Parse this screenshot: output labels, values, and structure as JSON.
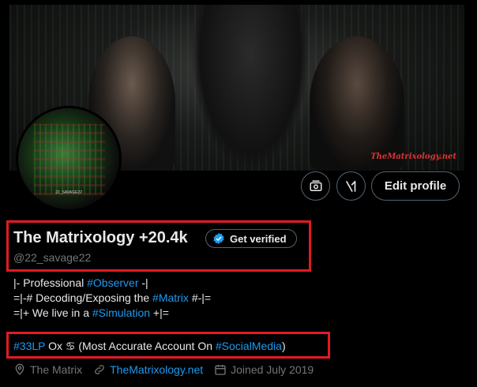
{
  "banner": {
    "watermark": "TheMatrixology.net",
    "avatar_caption": "22_SAVAGE22"
  },
  "actions": {
    "subscriptions_icon": "money-icon",
    "grok_icon": "grok-icon",
    "edit_profile_label": "Edit profile"
  },
  "profile": {
    "display_name": "The Matrixology +20.4k",
    "get_verified_label": "Get verified",
    "handle": "@22_savage22"
  },
  "bio": {
    "line1_prefix": "|- Professional ",
    "line1_tag": "#Observer",
    "line1_suffix": " -|",
    "line2_prefix": "=|-# Decoding/Exposing the ",
    "line2_tag": "#Matrix",
    "line2_suffix": " #-|=",
    "line3_prefix": "=|+ We live in a ",
    "line3_tag": "#Simulation",
    "line3_suffix": " +|="
  },
  "tagline": {
    "tag1": "#33LP",
    "text1": " Ox ",
    "zodiac": "♋",
    "text2": " (Most Accurate Account On ",
    "tag2": "#SocialMedia",
    "text3": ")"
  },
  "meta": {
    "location": "The Matrix",
    "website": "TheMatrixology.net",
    "joined": "Joined July 2019"
  },
  "colors": {
    "accent": "#1d9bf0",
    "highlight_box": "#e11b22",
    "muted": "#71767b"
  }
}
